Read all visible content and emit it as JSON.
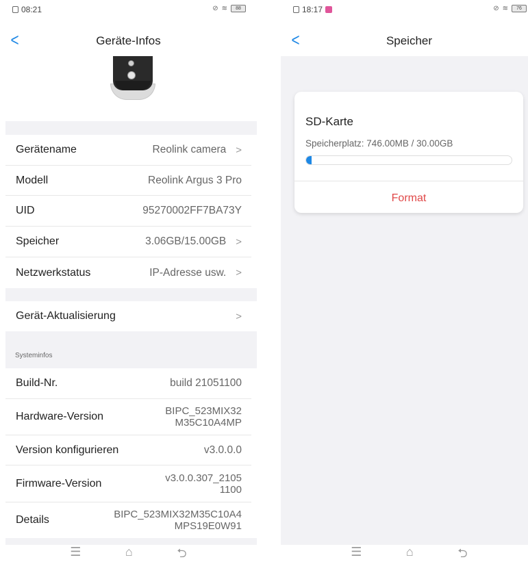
{
  "left": {
    "status": {
      "time": "08:21",
      "battery": "88"
    },
    "nav": {
      "back_icon": "chevron-left-icon",
      "title": "Geräte-Infos"
    },
    "rows": [
      {
        "label": "Gerätename",
        "value": "Reolink camera",
        "chevron": true
      },
      {
        "label": "Modell",
        "value": "Reolink Argus 3 Pro",
        "chevron": false
      },
      {
        "label": "UID",
        "value": "95270002FF7BA73Y",
        "chevron": false
      },
      {
        "label": "Speicher",
        "value": "3.06GB/15.00GB",
        "chevron": true
      },
      {
        "label": "Netzwerkstatus",
        "value": "IP-Adresse usw.",
        "chevron": true
      }
    ],
    "update": {
      "label": "Gerät-Aktualisierung"
    },
    "section": "Systeminfos",
    "sys_rows": [
      {
        "label": "Build-Nr.",
        "value": "build 21051100"
      },
      {
        "label": "Hardware-Version",
        "value_line1": "BIPC_523MIX32",
        "value_line2": "M35C10A4MP"
      },
      {
        "label": "Version konfigurieren",
        "value": "v3.0.0.0"
      },
      {
        "label": "Firmware-Version",
        "value_line1": "v3.0.0.307_2105",
        "value_line2": "1100"
      },
      {
        "label": "Details",
        "value_line1": "BIPC_523MIX32M35C10A4",
        "value_line2": "MPS19E0W91"
      }
    ],
    "bottom_icons": [
      "menu-icon",
      "home-icon",
      "back-icon"
    ]
  },
  "right": {
    "status": {
      "time": "18:17",
      "battery": "76"
    },
    "nav": {
      "back_icon": "chevron-left-icon",
      "title": "Speicher"
    },
    "card": {
      "title": "SD-Karte",
      "storage": "Speicherplatz: 746.00MB / 30.00GB",
      "used_fraction": 0.024,
      "format_label": "Format"
    },
    "colors": {
      "accent": "#1e88e5",
      "danger": "#e04848"
    }
  }
}
